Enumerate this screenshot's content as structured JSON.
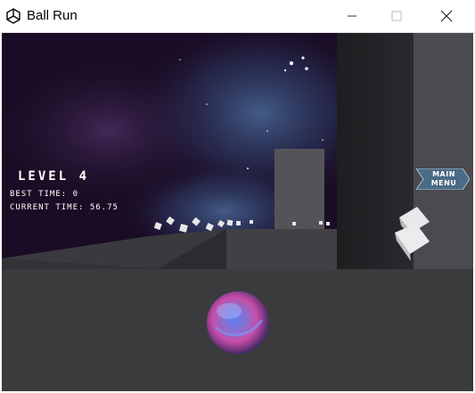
{
  "window": {
    "title": "Ball Run"
  },
  "hud": {
    "level": "LEVEL 4",
    "best_time": "BEST TIME: 0",
    "current_time": "CURRENT TIME: 56.75"
  },
  "menu_button": {
    "line1": "MAIN",
    "line2": "MENU"
  },
  "colors": {
    "space": "#1a0c24",
    "ground": "#3b3b3d",
    "ball": "#8a6fd0",
    "menu_button": "#4b6a86"
  }
}
